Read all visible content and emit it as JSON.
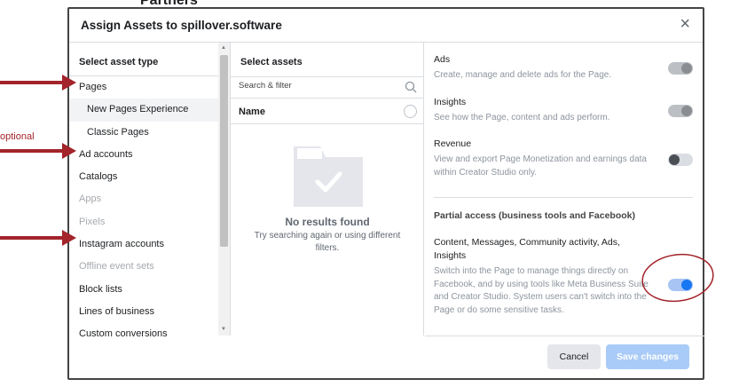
{
  "background": {
    "partial_text": "Partners"
  },
  "dialog": {
    "title": "Assign Assets to spillover.software",
    "close_glyph": "×"
  },
  "asset_types": {
    "header": "Select asset type",
    "items": [
      {
        "label": "Pages",
        "sub": false,
        "selected": false,
        "disabled": false
      },
      {
        "label": "New Pages Experience",
        "sub": true,
        "selected": true,
        "disabled": false
      },
      {
        "label": "Classic Pages",
        "sub": true,
        "selected": false,
        "disabled": false
      },
      {
        "label": "Ad accounts",
        "sub": false,
        "selected": false,
        "disabled": false
      },
      {
        "label": "Catalogs",
        "sub": false,
        "selected": false,
        "disabled": false
      },
      {
        "label": "Apps",
        "sub": false,
        "selected": false,
        "disabled": true
      },
      {
        "label": "Pixels",
        "sub": false,
        "selected": false,
        "disabled": true
      },
      {
        "label": "Instagram accounts",
        "sub": false,
        "selected": false,
        "disabled": false
      },
      {
        "label": "Offline event sets",
        "sub": false,
        "selected": false,
        "disabled": true
      },
      {
        "label": "Block lists",
        "sub": false,
        "selected": false,
        "disabled": false
      },
      {
        "label": "Lines of business",
        "sub": false,
        "selected": false,
        "disabled": false
      },
      {
        "label": "Custom conversions",
        "sub": false,
        "selected": false,
        "disabled": false
      }
    ]
  },
  "assets": {
    "header": "Select assets",
    "search_placeholder": "Search & filter",
    "name_header": "Name",
    "empty_title": "No results found",
    "empty_subtitle": "Try searching again or using different filters."
  },
  "permissions": {
    "items": [
      {
        "title": "Ads",
        "desc": "Create, manage and delete ads for the Page.",
        "toggle": "on-grey"
      },
      {
        "title": "Insights",
        "desc": "See how the Page, content and ads perform.",
        "toggle": "on-grey"
      },
      {
        "title": "Revenue",
        "desc": "View and export Page Monetization and earnings data within Creator Studio only.",
        "toggle": "off"
      }
    ],
    "partial_header": "Partial access (business tools and Facebook)",
    "partial_item": {
      "title": "Content, Messages, Community activity, Ads, Insights",
      "desc": "Switch into the Page to manage things directly on Facebook, and by using tools like Meta Business Suite and Creator Studio. System users can't switch into the Page or do some sensitive tasks.",
      "toggle": "on-blue"
    }
  },
  "footer": {
    "cancel": "Cancel",
    "save": "Save changes"
  },
  "annotations": {
    "optional_label": "optional",
    "color": "#a3242b"
  },
  "colors": {
    "accent": "#1877f2",
    "save_disabled": "#a9cbf7"
  }
}
